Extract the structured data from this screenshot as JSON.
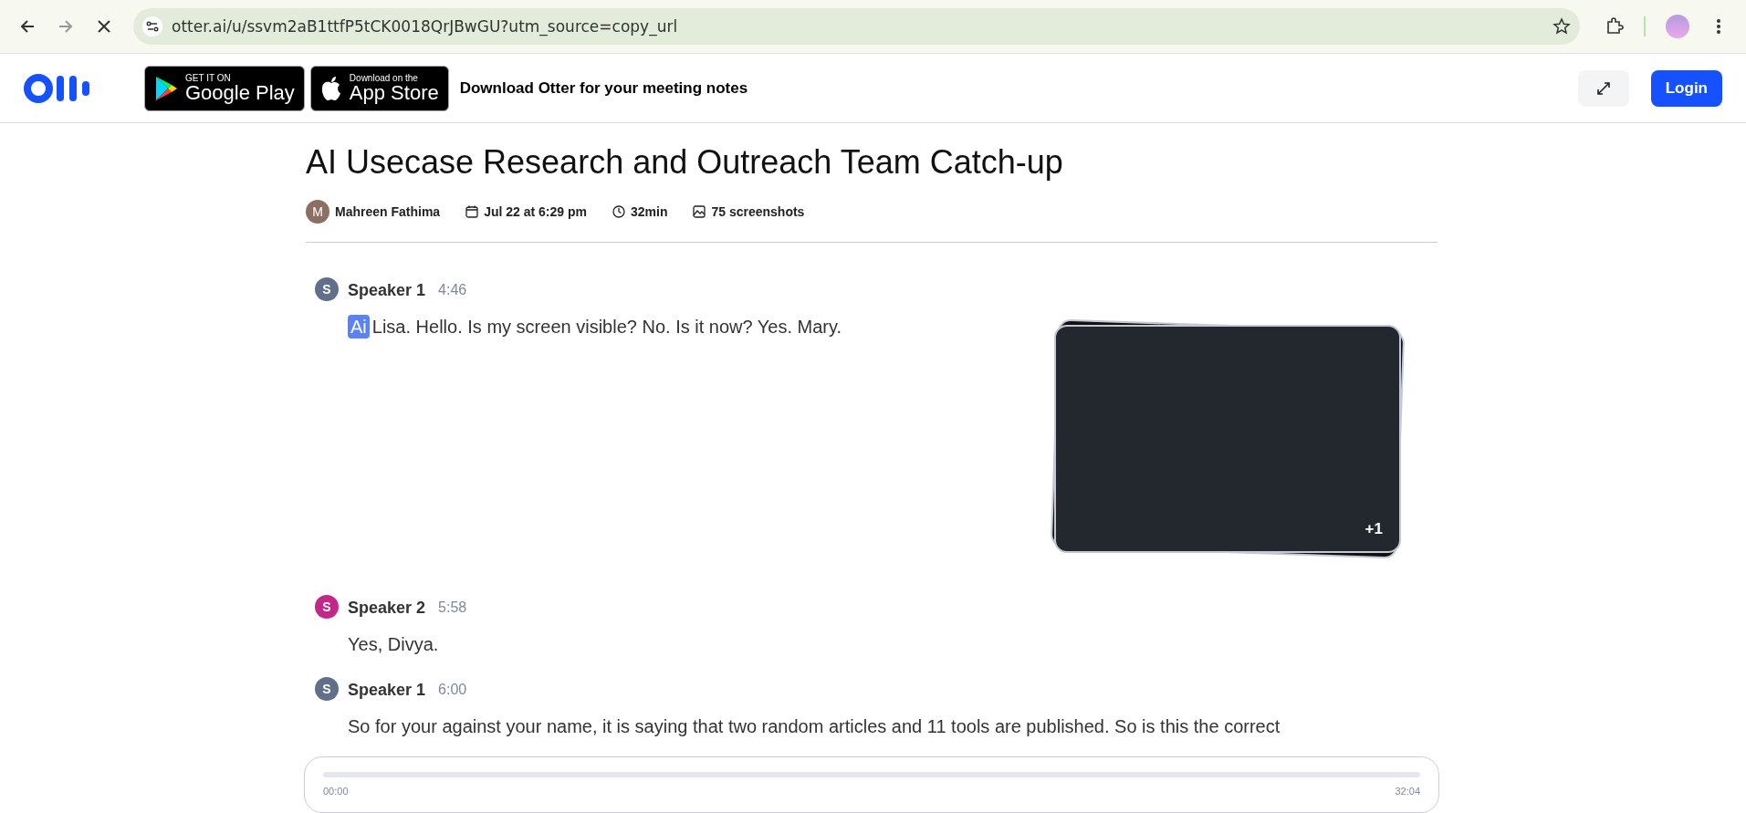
{
  "browser": {
    "url": "otter.ai/u/ssvm2aB1ttfP5tCK0018QrJBwGU?utm_source=copy_url"
  },
  "header": {
    "store_badges": [
      {
        "kind": "google",
        "small": "GET IT ON",
        "big": "Google Play"
      },
      {
        "kind": "apple",
        "small": "Download on the",
        "big": "App Store"
      }
    ],
    "tagline": "Download Otter for your meeting notes",
    "login": "Login"
  },
  "meeting": {
    "title": "AI Usecase Research and Outreach Team Catch-up",
    "owner": {
      "initial": "M",
      "name": "Mahreen Fathima"
    },
    "date": "Jul 22 at 6:29 pm",
    "duration": "32min",
    "screenshots": "75 screenshots"
  },
  "transcript": [
    {
      "initial": "S",
      "speaker": "Speaker 1",
      "time": "4:46",
      "color": "#617088",
      "badge": "Ai",
      "text": "Lisa. Hello. Is my screen visible? No. Is it now? Yes. Mary.",
      "screenshot": {
        "more": "+1"
      }
    },
    {
      "initial": "S",
      "speaker": "Speaker 2",
      "time": "5:58",
      "color": "#c2288a",
      "text": "Yes, Divya."
    },
    {
      "initial": "S",
      "speaker": "Speaker 1",
      "time": "6:00",
      "color": "#617088",
      "text": "So for your against your name, it is saying that two random articles and 11 tools are published. So is this the correct"
    }
  ],
  "player": {
    "start": "00:00",
    "end": "32:04"
  }
}
